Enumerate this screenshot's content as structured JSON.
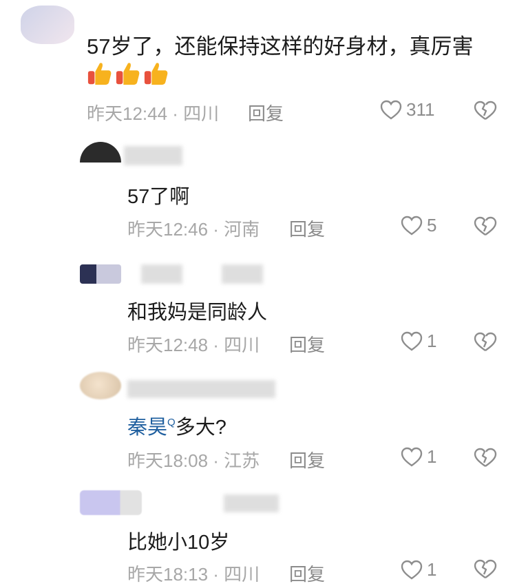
{
  "comments": [
    {
      "text": "57岁了，还能保持这样的好身材，真厉害",
      "emoji": [
        "thumbs-up",
        "thumbs-up",
        "thumbs-up"
      ],
      "meta": "昨天12:44 · 四川",
      "reply_label": "回复",
      "likes": "311"
    },
    {
      "text": "57了啊",
      "meta": "昨天12:46 · 河南",
      "reply_label": "回复",
      "likes": "5"
    },
    {
      "text": "和我妈是同龄人",
      "meta": "昨天12:48 · 四川",
      "reply_label": "回复",
      "likes": "1"
    },
    {
      "mention": "秦昊",
      "mention_badge": "Q",
      "text": "多大?",
      "meta": "昨天18:08 · 江苏",
      "reply_label": "回复",
      "likes": "1"
    },
    {
      "text": "比她小10岁",
      "meta": "昨天18:13 · 四川",
      "reply_label": "回复",
      "likes": "1"
    }
  ],
  "colors": {
    "mention": "#1f5f9f",
    "meta": "#a7a7a7",
    "reply": "#8b8b8b",
    "icon": "#8d8d8d"
  }
}
